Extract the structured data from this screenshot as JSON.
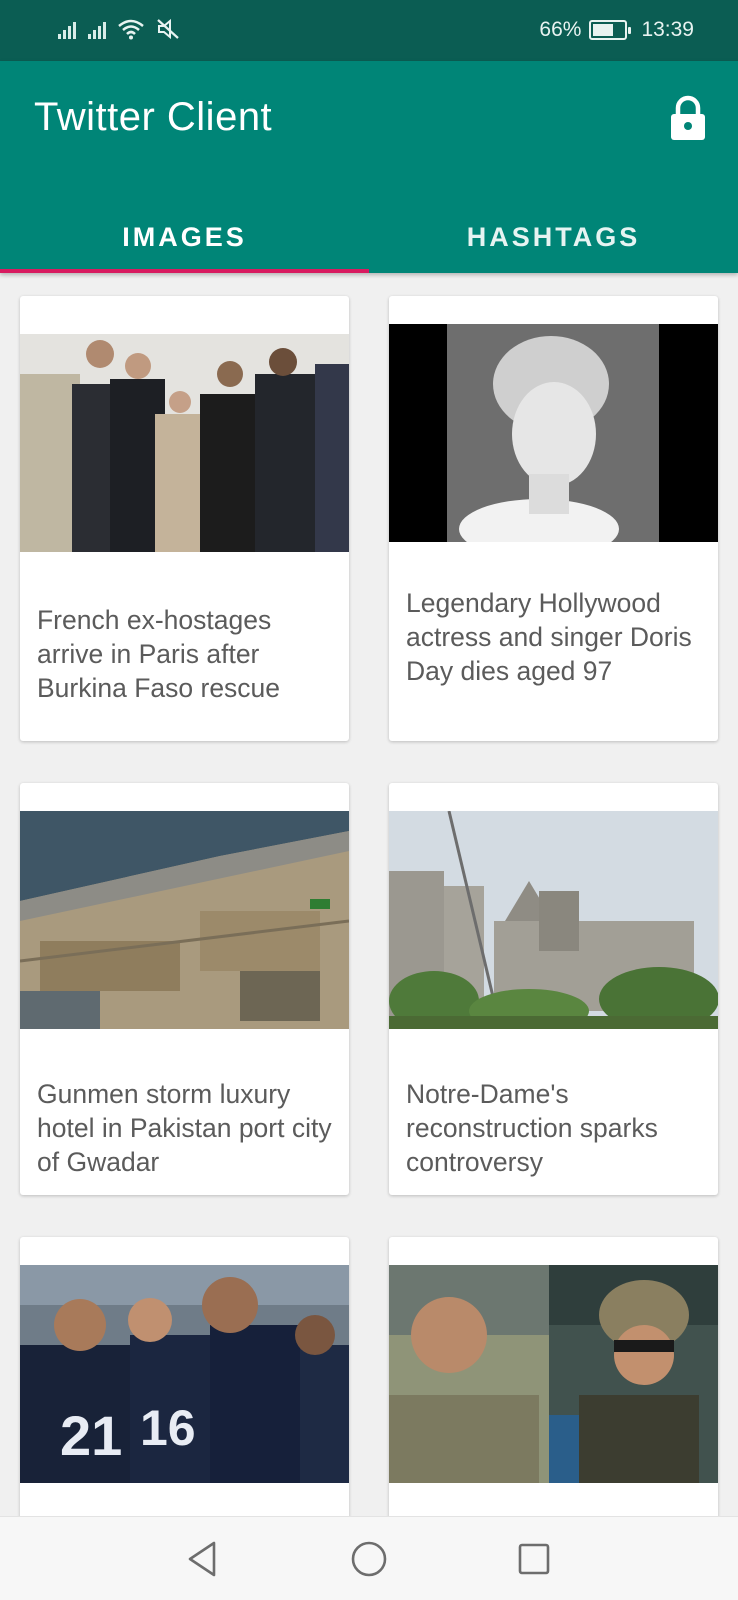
{
  "status_bar": {
    "battery_percent_label": "66%",
    "battery_level": 0.66,
    "time": "13:39",
    "icons": [
      "signal-icon",
      "signal-icon",
      "wifi-icon",
      "mute-icon",
      "battery-icon"
    ]
  },
  "app_bar": {
    "title": "Twitter Client",
    "action_icon": "lock-icon",
    "color": "#008577",
    "status_color": "#0b5d53"
  },
  "tabs": [
    {
      "label": "IMAGES",
      "selected": true
    },
    {
      "label": "HASHTAGS",
      "selected": false
    }
  ],
  "tab_indicator_color": "#d81b60",
  "cards": [
    {
      "caption": "French ex-hostages arrive in Paris after Burkina Faso rescue",
      "image": "group-walking-photo"
    },
    {
      "caption": "Legendary Hollywood actress and singer Doris Day dies aged 97",
      "image": "portrait-photo"
    },
    {
      "caption": "Gunmen storm luxury hotel in Pakistan port city of Gwadar",
      "image": "port-aerial-photo"
    },
    {
      "caption": "Notre-Dame's reconstruction sparks controversy",
      "image": "cathedral-photo"
    },
    {
      "caption": "",
      "image": "football-team-photo"
    },
    {
      "caption": "",
      "image": "soldiers-photo"
    }
  ],
  "nav_bar": {
    "icons": [
      "back-icon",
      "home-icon",
      "recents-icon"
    ]
  }
}
